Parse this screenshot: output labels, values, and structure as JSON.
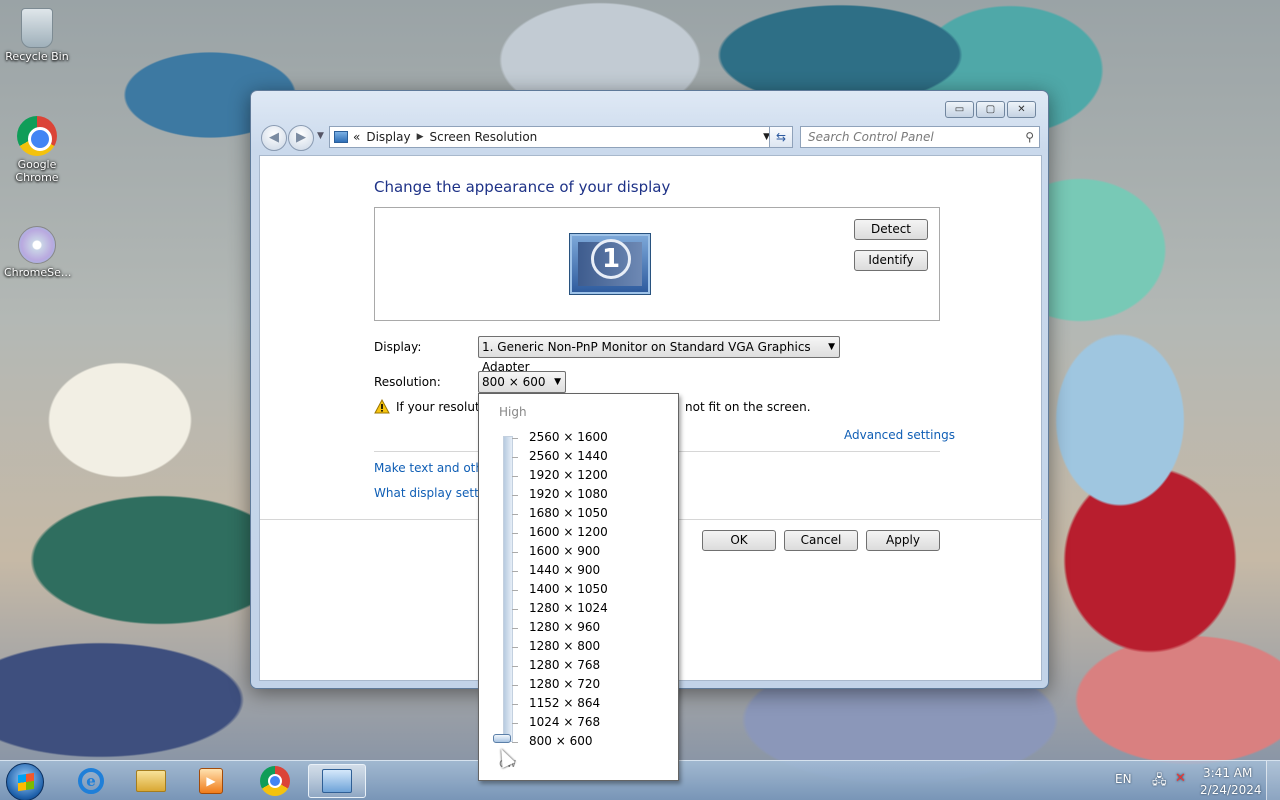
{
  "desktop": {
    "icons": [
      {
        "label": "Recycle Bin",
        "icon": "recycle-bin-icon"
      },
      {
        "label": "Google Chrome",
        "icon": "chrome-icon"
      },
      {
        "label": "ChromeSe...",
        "icon": "chrome-setup-icon"
      }
    ]
  },
  "window": {
    "breadcrumb": {
      "prefix": "«",
      "item1": "Display",
      "item2": "Screen Resolution"
    },
    "search_placeholder": "Search Control Panel",
    "controls": {
      "minimize": "▭",
      "maximize": "▢",
      "close": "✕"
    }
  },
  "page": {
    "heading": "Change the appearance of your display",
    "monitor_number": "1",
    "detect_label": "Detect",
    "identify_label": "Identify",
    "display_label": "Display:",
    "display_value": "1. Generic Non-PnP Monitor on Standard VGA Graphics Adapter",
    "resolution_label": "Resolution:",
    "resolution_value": "800 × 600",
    "warning_start": "If your resolutio",
    "warning_end": "not fit on the screen.",
    "advanced_link": "Advanced settings",
    "link1": "Make text and other",
    "link2": "What display setting",
    "ok_label": "OK",
    "cancel_label": "Cancel",
    "apply_label": "Apply"
  },
  "dropdown": {
    "high_label": "High",
    "low_label": "ow",
    "options": [
      "2560 × 1600",
      "2560 × 1440",
      "1920 × 1200",
      "1920 × 1080",
      "1680 × 1050",
      "1600 × 1200",
      "1600 × 900",
      "1440 × 900",
      "1400 × 1050",
      "1280 × 1024",
      "1280 × 960",
      "1280 × 800",
      "1280 × 768",
      "1280 × 720",
      "1152 × 864",
      "1024 × 768",
      "800 × 600"
    ],
    "selected": "800 × 600"
  },
  "taskbar": {
    "language": "EN",
    "time": "3:41 AM",
    "date": "2/24/2024"
  },
  "colors": {
    "heading": "#1e3287",
    "link": "#0f5eb5"
  }
}
